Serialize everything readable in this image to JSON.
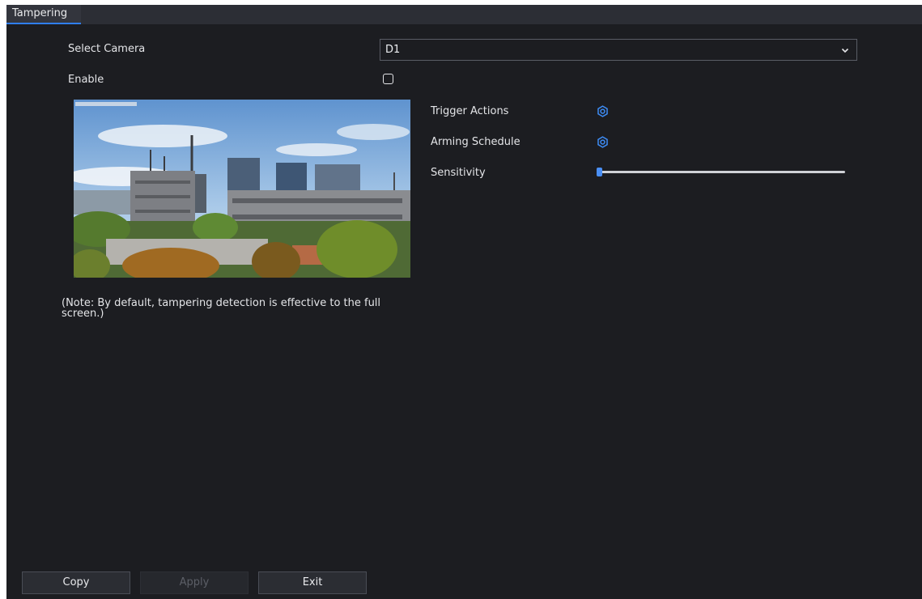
{
  "tabs": [
    {
      "label": "Tampering",
      "active": true
    }
  ],
  "form": {
    "select_camera_label": "Select Camera",
    "select_camera_value": "D1",
    "enable_label": "Enable",
    "enable_checked": false,
    "note": "(Note: By default, tampering detection is effective to the full screen.)"
  },
  "settings": {
    "trigger_actions_label": "Trigger Actions",
    "arming_schedule_label": "Arming Schedule",
    "sensitivity_label": "Sensitivity",
    "sensitivity_fraction": 0.0
  },
  "buttons": {
    "copy": "Copy",
    "apply": "Apply",
    "exit": "Exit"
  },
  "colors": {
    "accent": "#2f7ef0",
    "background": "#1c1d21",
    "tab_bar": "#2c2e35"
  },
  "icons": {
    "trigger_actions": "gear-icon",
    "arming_schedule": "gear-icon",
    "dropdown": "chevron-down-icon"
  }
}
